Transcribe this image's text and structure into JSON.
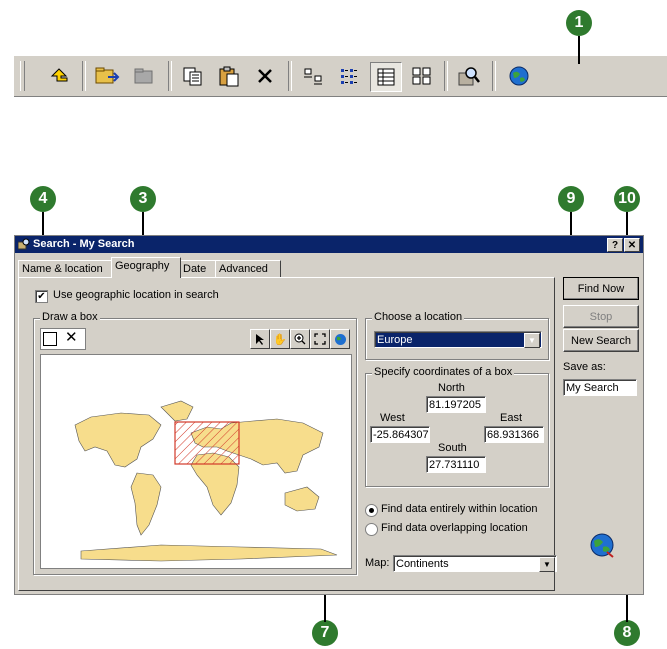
{
  "callouts": {
    "c1": "1",
    "c3": "3",
    "c4": "4",
    "c7": "7",
    "c8": "8",
    "c9": "9",
    "c10": "10"
  },
  "toolbar": {
    "icons": [
      "up-one-level",
      "connect-folder",
      "disconnect-folder",
      "copy",
      "paste",
      "delete",
      "large-icons",
      "list",
      "details",
      "thumbnails",
      "search",
      "launch-arcmap"
    ]
  },
  "dialog": {
    "title": "Search - My Search",
    "help_glyph": "?",
    "close_glyph": "✕",
    "tabs": [
      {
        "label": "Name & location"
      },
      {
        "label": "Geography",
        "selected": true
      },
      {
        "label": "Date"
      },
      {
        "label": "Advanced"
      }
    ],
    "use_geo_label": "Use geographic location in search",
    "use_geo_checked": true,
    "draw_box_label": "Draw a box",
    "choose_location_label": "Choose a location",
    "location_value": "Europe",
    "coords_label": "Specify coordinates of a box",
    "north_label": "North",
    "north_value": "81.197205",
    "west_label": "West",
    "west_value": "-25.864307",
    "east_label": "East",
    "east_value": "68.931366",
    "south_label": "South",
    "south_value": "27.731110",
    "radio_within": "Find data entirely within location",
    "radio_overlap": "Find data overlapping location",
    "map_label": "Map:",
    "map_value": "Continents",
    "find_now": "Find Now",
    "stop": "Stop",
    "new_search": "New Search",
    "save_as_label": "Save as:",
    "save_as_value": "My Search"
  },
  "colors": {
    "callout": "#2f7a2e",
    "titlebar": "#0a246a",
    "land": "#f7dd8c",
    "selection": "#d33a2a",
    "dialog_face": "#d4d0c8"
  }
}
